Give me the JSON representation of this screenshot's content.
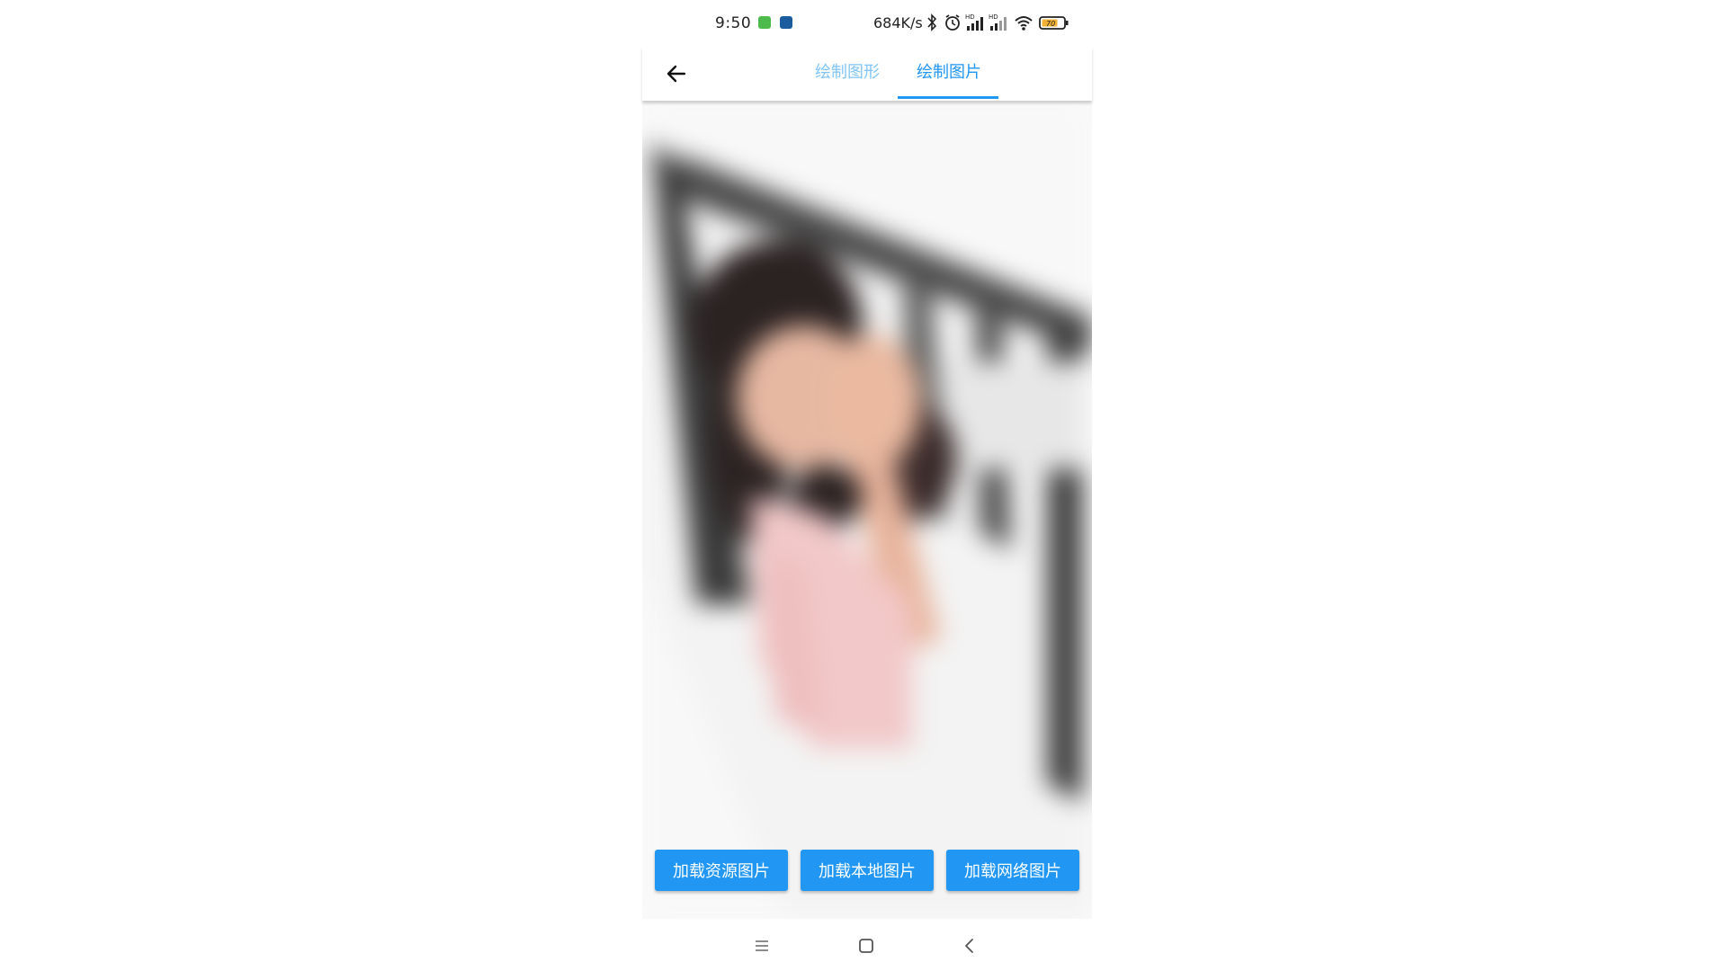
{
  "status_bar": {
    "time": "9:50",
    "speed": "684K/s",
    "battery_level": "70",
    "icons": [
      "notification-green-icon",
      "notification-blue-icon",
      "bluetooth-icon",
      "alarm-icon",
      "signal-hd-icon",
      "signal-hd-icon",
      "wifi-icon",
      "battery-icon"
    ]
  },
  "header": {
    "back_icon": "arrow-left-icon",
    "tabs": [
      {
        "label": "绘制图形",
        "selected": false
      },
      {
        "label": "绘制图片",
        "selected": true
      }
    ]
  },
  "canvas": {
    "content": "blurred-photo"
  },
  "buttons": {
    "load_resource": "加载资源图片",
    "load_local": "加载本地图片",
    "load_network": "加载网络图片"
  },
  "nav_bar": {
    "icons": [
      "menu-icon",
      "home-icon",
      "back-chevron-icon"
    ]
  },
  "colors": {
    "accent": "#2196f3",
    "tab_inactive": "#80c4f5"
  }
}
